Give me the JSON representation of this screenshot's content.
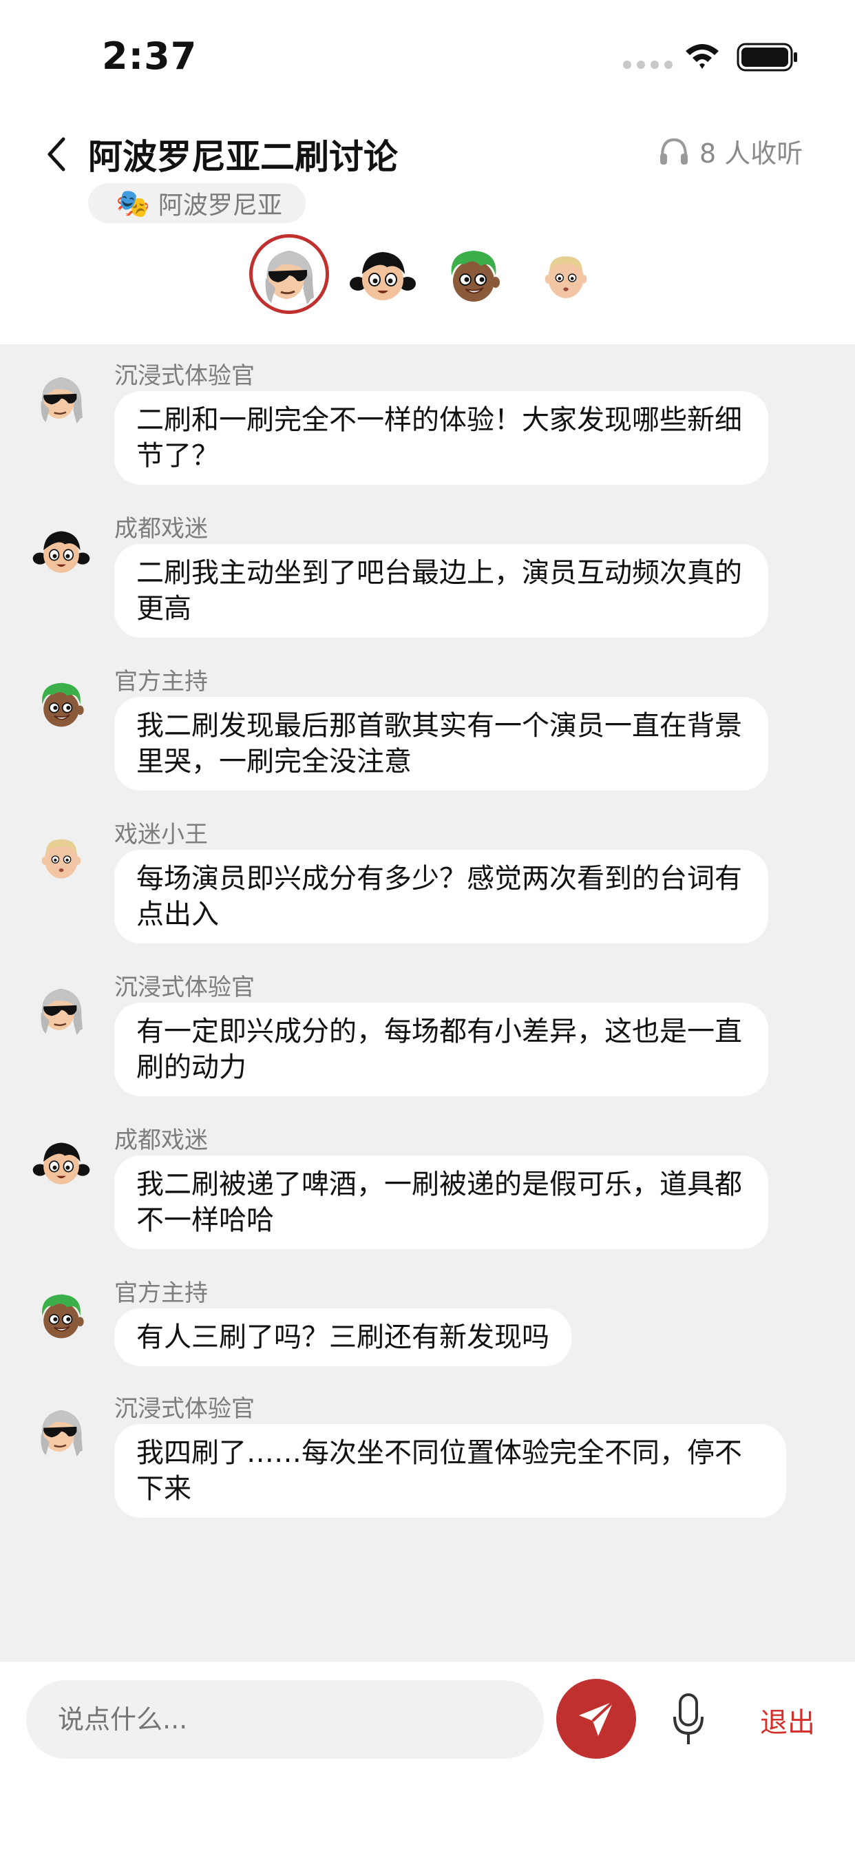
{
  "status_bar": {
    "time": "2:37"
  },
  "header": {
    "title": "阿波罗尼亚二刷讨论",
    "listeners": "8 人收听",
    "tag_icon": "🎭",
    "tag_label": "阿波罗尼亚"
  },
  "avatars": [
    "gray-hair-sunglasses-avatar",
    "black-hair-girl-avatar",
    "green-hair-boy-avatar",
    "blond-kid-avatar"
  ],
  "messages": [
    {
      "name": "沉浸式体验官",
      "avatar": "gray-hair-sunglasses-avatar",
      "text": "二刷和一刷完全不一样的体验！大家发现哪些新细节了？"
    },
    {
      "name": "成都戏迷",
      "avatar": "black-hair-girl-avatar",
      "text": "二刷我主动坐到了吧台最边上，演员互动频次真的更高"
    },
    {
      "name": "官方主持",
      "avatar": "green-hair-boy-avatar",
      "text": "我二刷发现最后那首歌其实有一个演员一直在背景里哭，一刷完全没注意"
    },
    {
      "name": "戏迷小王",
      "avatar": "blond-kid-avatar",
      "text": "每场演员即兴成分有多少？感觉两次看到的台词有点出入"
    },
    {
      "name": "沉浸式体验官",
      "avatar": "gray-hair-sunglasses-avatar",
      "text": "有一定即兴成分的，每场都有小差异，这也是一直刷的动力"
    },
    {
      "name": "成都戏迷",
      "avatar": "black-hair-girl-avatar",
      "text": "我二刷被递了啤酒，一刷被递的是假可乐，道具都不一样哈哈"
    },
    {
      "name": "官方主持",
      "avatar": "green-hair-boy-avatar",
      "text": "有人三刷了吗？三刷还有新发现吗"
    },
    {
      "name": "沉浸式体验官",
      "avatar": "gray-hair-sunglasses-avatar",
      "text": "我四刷了……每次坐不同位置体验完全不同，停不下来"
    }
  ],
  "input": {
    "placeholder": "说点什么..."
  },
  "exit_label": "退出",
  "colors": {
    "accent": "#c0302f",
    "exit": "#d4302c",
    "chat_bg": "#f0f0f0"
  }
}
